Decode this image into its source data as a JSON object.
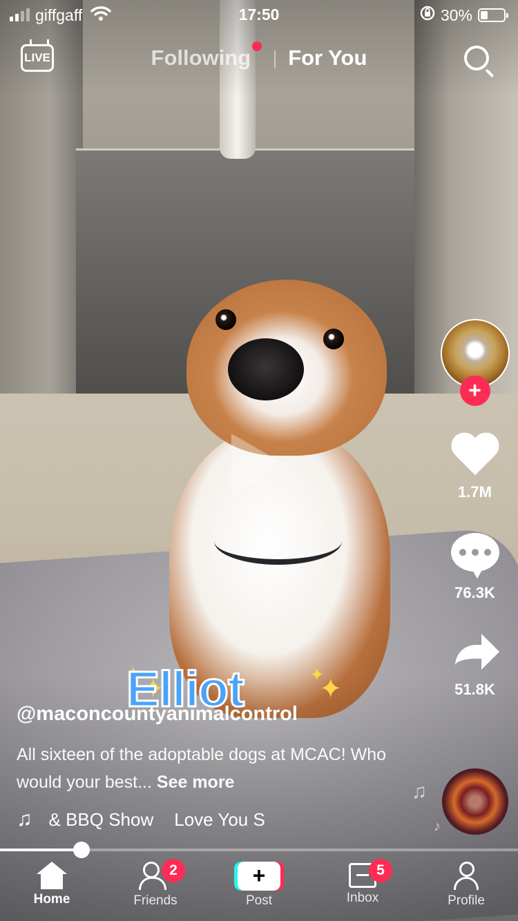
{
  "status_bar": {
    "carrier": "giffgaff",
    "time": "17:50",
    "battery": "30%"
  },
  "top_nav": {
    "live_label": "LIVE",
    "following_label": "Following",
    "for_you_label": "For You"
  },
  "actions": {
    "likes": "1.7M",
    "comments": "76.3K",
    "shares": "51.8K"
  },
  "video": {
    "sticker_text": "Elliot",
    "progress": 0.157
  },
  "caption": {
    "username": "@maconcountyanimalcontrol",
    "description": "All sixteen of the adoptable dogs at MCAC! Who would your best...",
    "see_more": "See more"
  },
  "music": {
    "track_1": "& BBQ Show",
    "track_2": "Love You S"
  },
  "tab_bar": {
    "home": "Home",
    "friends": "Friends",
    "friends_badge": "2",
    "post": "Post",
    "inbox": "Inbox",
    "inbox_badge": "5",
    "profile": "Profile"
  },
  "colors": {
    "accent": "#fe2c55",
    "accent_cyan": "#25f4ee",
    "sticker_blue": "#4aa3f7"
  },
  "icons": [
    "live-icon",
    "search-icon",
    "heart-icon",
    "comment-icon",
    "share-icon",
    "music-note-icon",
    "home-icon",
    "friends-icon",
    "post-icon",
    "inbox-icon",
    "profile-icon"
  ]
}
